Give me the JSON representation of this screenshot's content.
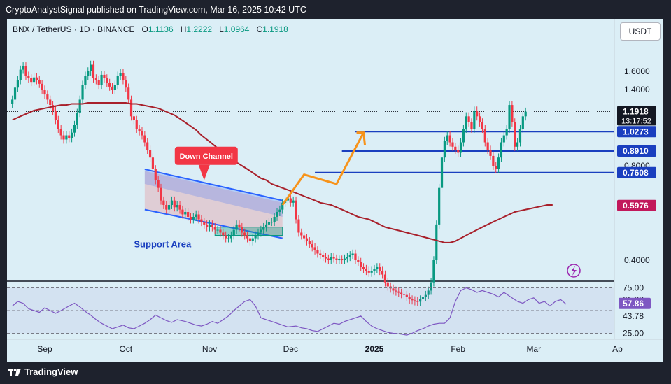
{
  "header": {
    "published_line": "CryptoAnalystSignal published on TradingView.com, Mar 16, 2025 10:42 UTC"
  },
  "symbol": {
    "name": "BNX / TetherUS · 1D · BINANCE",
    "open_label": "O",
    "open": "1.1136",
    "high_label": "H",
    "high": "1.2222",
    "low_label": "L",
    "low": "1.0964",
    "close_label": "C",
    "close": "1.1918"
  },
  "currency_button": "USDT",
  "footer": {
    "brand": "TradingView"
  },
  "colors": {
    "background": "#dbeef6",
    "up_candle": "#089981",
    "down_candle": "#f23645",
    "ma_line": "#a8202b",
    "rsi_line": "#7e57c2",
    "level_line": "#1a3fbf",
    "arrow": "#f7931a",
    "frame": "#1e222d"
  },
  "chart_data": {
    "type": "candlestick",
    "y_scale": "log",
    "price_axis_ticks": [
      "1.6000",
      "1.4000",
      "0.8000",
      "0.4000"
    ],
    "price_axis_tick_values": [
      1.6,
      1.4,
      0.8,
      0.4
    ],
    "price_labels": [
      {
        "text": "1.1918",
        "value": 1.1918,
        "sub": "13:17:52",
        "style": "current"
      },
      {
        "text": "1.0273",
        "value": 1.0273,
        "style": "blue"
      },
      {
        "text": "0.8910",
        "value": 0.891,
        "style": "blue"
      },
      {
        "text": "0.7608",
        "value": 0.7608,
        "style": "blue"
      },
      {
        "text": "0.5976",
        "value": 0.5976,
        "style": "red"
      }
    ],
    "x_ticks": [
      {
        "label": "Sep",
        "date": "2024-09-01",
        "bold": false
      },
      {
        "label": "Oct",
        "date": "2024-10-01",
        "bold": false
      },
      {
        "label": "Nov",
        "date": "2024-11-01",
        "bold": false
      },
      {
        "label": "Dec",
        "date": "2024-12-01",
        "bold": false
      },
      {
        "label": "2025",
        "date": "2025-01-01",
        "bold": true
      },
      {
        "label": "Feb",
        "date": "2025-02-01",
        "bold": false
      },
      {
        "label": "Mar",
        "date": "2025-03-01",
        "bold": false
      },
      {
        "label": "Ap",
        "date": "2025-04-01",
        "bold": false
      }
    ],
    "horizontal_levels": [
      {
        "value": 1.0273,
        "from": "2024-12-25",
        "to": "2025-03-20"
      },
      {
        "value": 0.891,
        "from": "2024-12-20",
        "to": "2025-03-20"
      },
      {
        "value": 0.7608,
        "from": "2024-12-10",
        "to": "2025-03-20"
      }
    ],
    "dotted_line_value": 1.1918,
    "series": [
      {
        "name": "Close",
        "dates_start": "2024-08-20",
        "close": [
          1.3,
          1.42,
          1.5,
          1.62,
          1.66,
          1.55,
          1.52,
          1.48,
          1.53,
          1.5,
          1.46,
          1.4,
          1.35,
          1.3,
          1.25,
          1.2,
          1.12,
          1.05,
          1.0,
          0.97,
          1.0,
          0.98,
          1.02,
          1.08,
          1.18,
          1.3,
          1.45,
          1.55,
          1.6,
          1.68,
          1.52,
          1.5,
          1.45,
          1.56,
          1.52,
          1.47,
          1.43,
          1.4,
          1.45,
          1.55,
          1.58,
          1.5,
          1.42,
          1.3,
          1.15,
          1.12,
          1.05,
          1.03,
          1.0,
          0.95,
          0.9,
          0.85,
          0.78,
          0.72,
          0.68,
          0.62,
          0.6,
          0.58,
          0.6,
          0.62,
          0.59,
          0.6,
          0.58,
          0.56,
          0.57,
          0.55,
          0.54,
          0.55,
          0.56,
          0.54,
          0.53,
          0.52,
          0.51,
          0.52,
          0.51,
          0.5,
          0.5,
          0.49,
          0.48,
          0.47,
          0.47,
          0.48,
          0.5,
          0.52,
          0.51,
          0.49,
          0.48,
          0.47,
          0.46,
          0.47,
          0.48,
          0.49,
          0.5,
          0.51,
          0.52,
          0.53,
          0.53,
          0.55,
          0.57,
          0.58,
          0.61,
          0.62,
          0.63,
          0.61,
          0.62,
          0.54,
          0.49,
          0.48,
          0.47,
          0.46,
          0.45,
          0.44,
          0.43,
          0.42,
          0.415,
          0.41,
          0.405,
          0.4,
          0.41,
          0.405,
          0.4,
          0.402,
          0.4,
          0.405,
          0.41,
          0.415,
          0.42,
          0.4,
          0.395,
          0.38,
          0.375,
          0.37,
          0.365,
          0.37,
          0.375,
          0.38,
          0.37,
          0.36,
          0.34,
          0.33,
          0.325,
          0.32,
          0.318,
          0.315,
          0.312,
          0.31,
          0.305,
          0.3,
          0.298,
          0.296,
          0.295,
          0.3,
          0.305,
          0.31,
          0.32,
          0.34,
          0.4,
          0.52,
          0.68,
          0.85,
          0.96,
          1.0,
          0.95,
          0.92,
          0.9,
          0.88,
          0.95,
          1.05,
          1.15,
          1.1,
          1.05,
          1.2,
          1.15,
          1.1,
          1.05,
          0.95,
          0.9,
          0.86,
          0.8,
          0.78,
          0.85,
          0.95,
          1.0,
          1.05,
          1.25,
          1.1,
          0.92,
          0.95,
          1.05,
          1.15,
          1.19
        ]
      },
      {
        "name": "MA",
        "dates_start": "2024-08-20",
        "values": [
          1.12,
          1.14,
          1.16,
          1.18,
          1.2,
          1.21,
          1.22,
          1.23,
          1.24,
          1.25,
          1.25,
          1.26,
          1.26,
          1.26,
          1.27,
          1.27,
          1.27,
          1.27,
          1.27,
          1.27,
          1.27,
          1.27,
          1.26,
          1.26,
          1.25,
          1.24,
          1.23,
          1.22,
          1.2,
          1.18,
          1.16,
          1.13,
          1.1,
          1.07,
          1.04,
          1.0,
          0.97,
          0.94,
          0.91,
          0.88,
          0.85,
          0.83,
          0.81,
          0.79,
          0.77,
          0.75,
          0.73,
          0.72,
          0.7,
          0.69,
          0.68,
          0.67,
          0.66,
          0.65,
          0.64,
          0.63,
          0.62,
          0.61,
          0.605,
          0.6,
          0.59,
          0.58,
          0.57,
          0.56,
          0.55,
          0.545,
          0.54,
          0.53,
          0.52,
          0.51,
          0.505,
          0.5,
          0.495,
          0.49,
          0.485,
          0.48,
          0.475,
          0.47,
          0.465,
          0.46,
          0.455,
          0.455,
          0.46,
          0.47,
          0.48,
          0.49,
          0.5,
          0.51,
          0.52,
          0.53,
          0.54,
          0.55,
          0.56,
          0.57,
          0.575,
          0.58,
          0.585,
          0.59,
          0.595,
          0.6,
          0.6
        ]
      },
      {
        "name": "RSI",
        "levels_shown": [
          "75.00",
          "61.98",
          "57.86",
          "43.78",
          "25.00"
        ],
        "current_values": [
          "61.98",
          "57.86",
          "43.78"
        ]
      }
    ],
    "annotations": [
      {
        "text": "Down Channel",
        "type": "callout"
      },
      {
        "text": "Support Area",
        "type": "label"
      }
    ]
  }
}
